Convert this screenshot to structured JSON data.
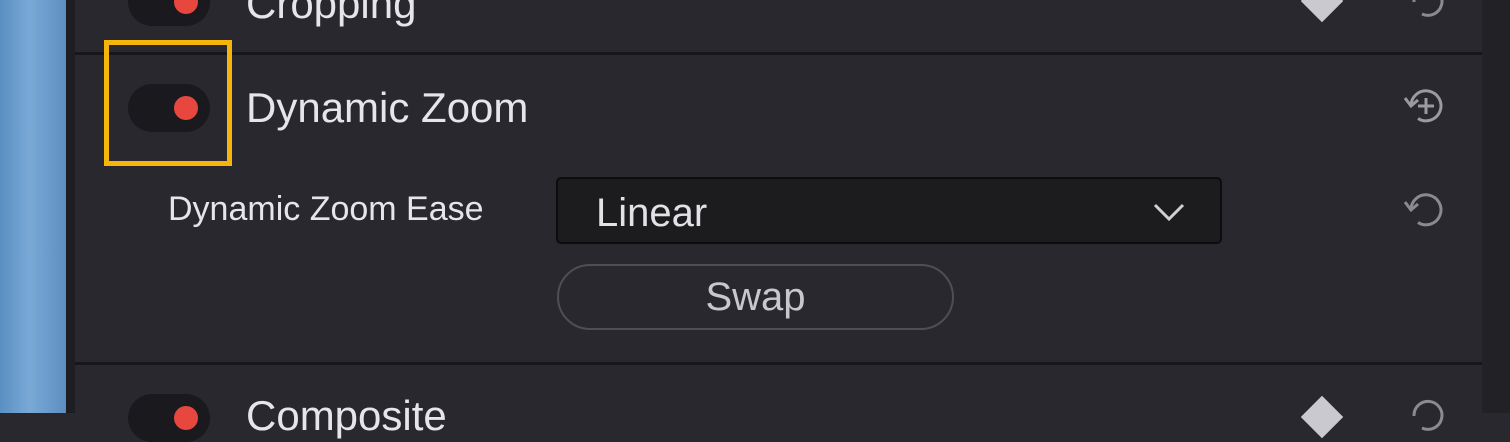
{
  "sections": {
    "cropping": {
      "title": "Cropping",
      "enabled": true
    },
    "dynamic_zoom": {
      "title": "Dynamic Zoom",
      "enabled": true,
      "ease_label": "Dynamic Zoom Ease",
      "ease_value": "Linear",
      "swap_label": "Swap"
    },
    "composite": {
      "title": "Composite",
      "enabled": true
    }
  },
  "icons": {
    "toggle": "toggle-switch-icon",
    "reset": "reset-icon",
    "keyframe": "keyframe-diamond-icon",
    "dropdown": "chevron-down-icon"
  },
  "colors": {
    "toggle_on": "#e8473f",
    "highlight": "#f5b50d",
    "panel_bg": "#28282e"
  }
}
